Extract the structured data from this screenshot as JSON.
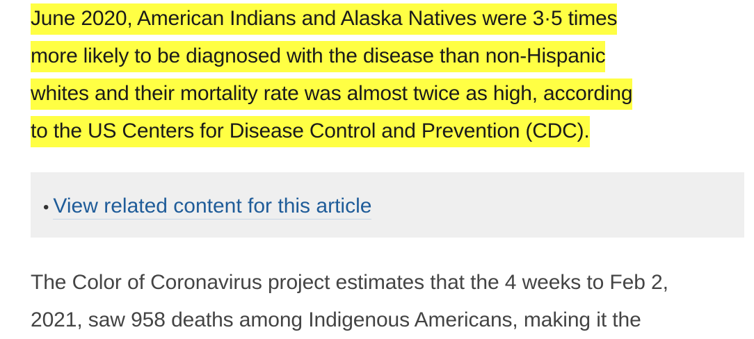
{
  "highlight_color": "#ffff44",
  "link_color": "#1f5c99",
  "highlighted_paragraph": {
    "lines": [
      "June 2020, American Indians and Alaska Natives were 3·5 times",
      "more likely to be diagnosed with the disease than non-Hispanic",
      "whites and their mortality rate was almost twice as high, according",
      "to the US Centers for Disease Control and Prevention (CDC)."
    ]
  },
  "related": {
    "bullet": "•",
    "link_label": "View related content for this article"
  },
  "body_paragraph": {
    "lines": [
      "The Color of Coronavirus project estimates that the 4 weeks to Feb 2,",
      "2021, saw 958 deaths among Indigenous Americans, making it the"
    ]
  }
}
